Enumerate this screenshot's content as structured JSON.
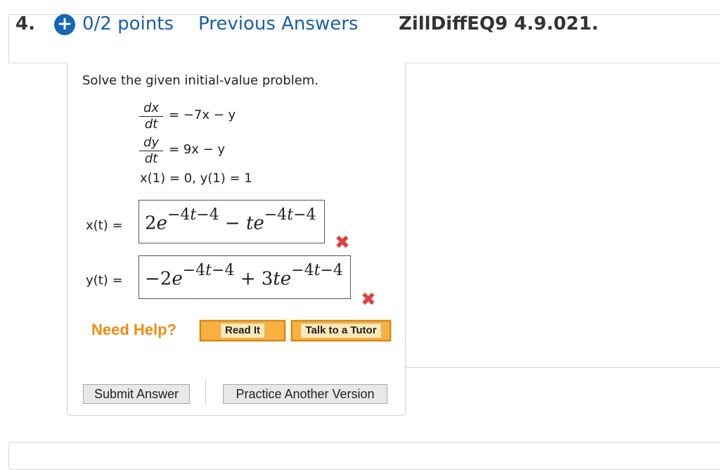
{
  "header": {
    "question_number": "4.",
    "plus_symbol": "+",
    "points": "0/2 points",
    "previous_answers": "Previous Answers",
    "code": "ZillDiffEQ9 4.9.021."
  },
  "problem": {
    "prompt": "Solve the given initial-value problem.",
    "eq1": {
      "num": "dx",
      "den": "dt",
      "rhs": "= −7x − y"
    },
    "eq2": {
      "num": "dy",
      "den": "dt",
      "rhs": "= 9x − y"
    },
    "initial": "x(1) = 0, y(1) = 1"
  },
  "answers": [
    {
      "label": "x(t) =",
      "expression": "2e^(−4t−4) − te^(−4t−4)",
      "status": "incorrect"
    },
    {
      "label": "y(t) =",
      "expression": "−2e^(−4t−4) + 3te^(−4t−4)",
      "status": "incorrect"
    }
  ],
  "help": {
    "need_help": "Need Help?",
    "read_it": "Read It",
    "talk_to_tutor": "Talk to a Tutor"
  },
  "actions": {
    "submit": "Submit Answer",
    "practice": "Practice Another Version"
  },
  "colors": {
    "link_blue": "#1a5fa8",
    "incorrect_red": "#e04040",
    "help_orange": "#f08c10"
  }
}
